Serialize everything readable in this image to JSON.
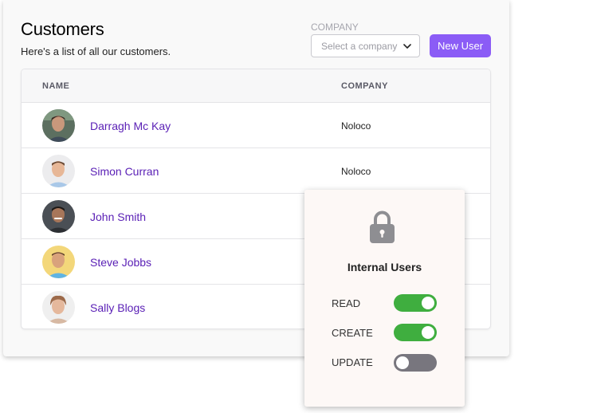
{
  "header": {
    "title": "Customers",
    "subtitle": "Here's a list of all our customers."
  },
  "filter": {
    "label": "COMPANY",
    "placeholder": "Select a company",
    "icon": "chevron-down-icon"
  },
  "actions": {
    "new_user_label": "New User",
    "new_user_color": "#8b5cf6"
  },
  "table": {
    "columns": [
      "NAME",
      "COMPANY"
    ],
    "rows": [
      {
        "name": "Darragh Mc Kay",
        "company": "Noloco",
        "avatar": "avatar-photo"
      },
      {
        "name": "Simon Curran",
        "company": "Noloco",
        "avatar": "avatar-photo"
      },
      {
        "name": "John Smith",
        "company": "",
        "avatar": "avatar-photo"
      },
      {
        "name": "Steve Jobbs",
        "company": "",
        "avatar": "avatar-photo"
      },
      {
        "name": "Sally Blogs",
        "company": "",
        "avatar": "avatar-photo"
      }
    ],
    "name_color": "#5b21b6"
  },
  "permissions_popup": {
    "icon": "lock-icon",
    "title": "Internal Users",
    "permissions": [
      {
        "label": "READ",
        "enabled": true
      },
      {
        "label": "CREATE",
        "enabled": true
      },
      {
        "label": "UPDATE",
        "enabled": false
      }
    ],
    "on_color": "#3fae3f",
    "off_color": "#78767e"
  }
}
